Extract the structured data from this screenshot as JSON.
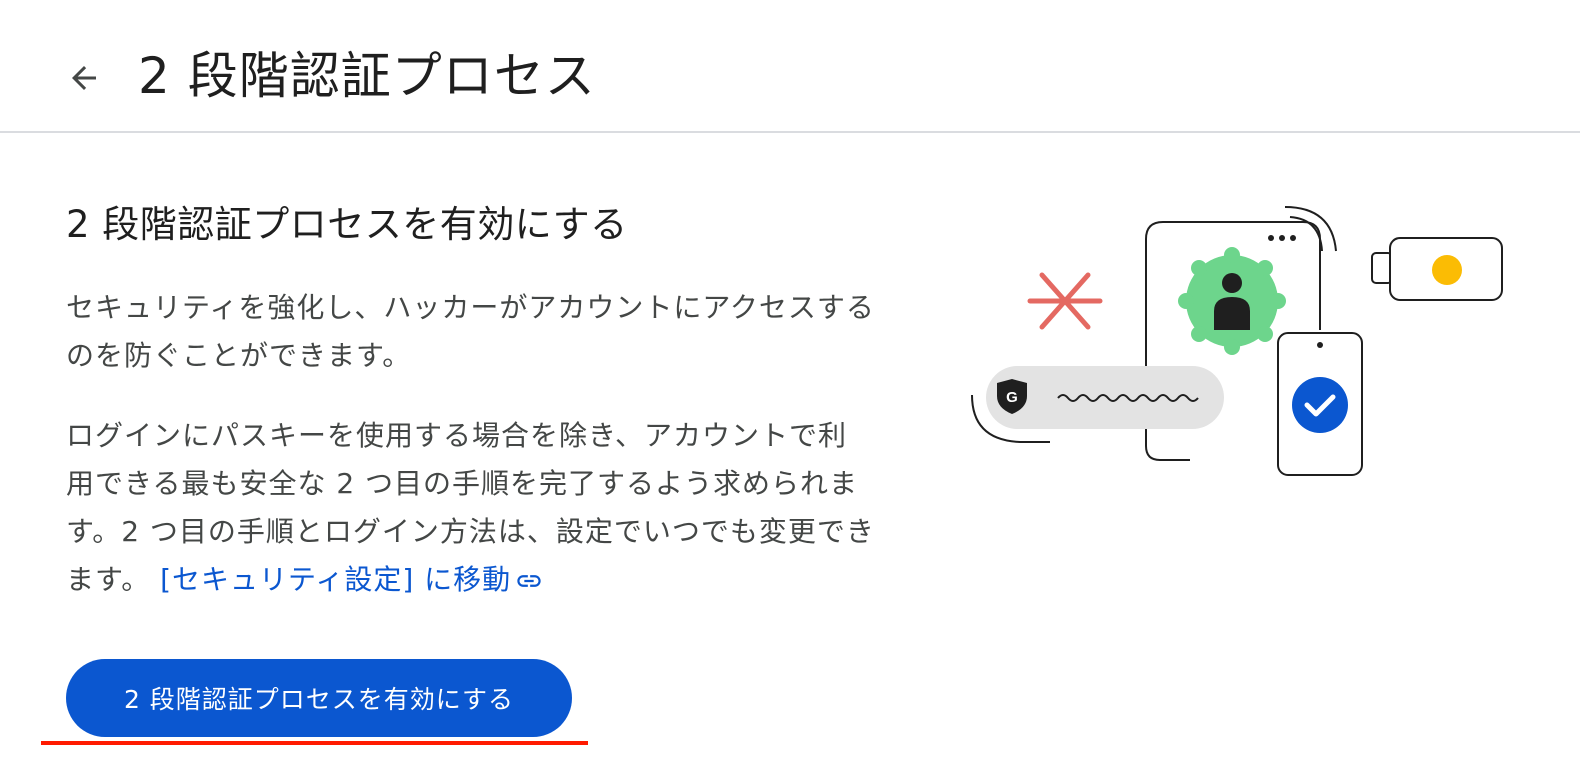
{
  "header": {
    "back_icon": "arrow-back-icon",
    "title": "2 段階認証プロセス"
  },
  "main": {
    "section_title": "2 段階認証プロセスを有効にする",
    "paragraph1": "セキュリティを強化し、ハッカーがアカウントにアクセスするのを防ぐことができます。",
    "paragraph2_text": "ログインにパスキーを使用する場合を除き、アカウントで利用できる最も安全な 2 つ目の手順を完了するよう求められます。2 つ目の手順とログイン方法は、設定でいつでも変更できます。",
    "paragraph2_link": "[セキュリティ設定] に移動",
    "link_icon": "link-icon",
    "button_label": "2 段階認証プロセスを有効にする"
  },
  "colors": {
    "accent": "#0b57d0",
    "annotation_underline": "#ff1a00",
    "illustration_green": "#6dd58c",
    "illustration_yellow": "#fbbc04",
    "illustration_red": "#e46962"
  },
  "illustration": {
    "icons": [
      "google-shield-icon",
      "person-badge-icon",
      "checkmark-circle-icon",
      "security-key-icon",
      "asterisk-icon"
    ]
  }
}
